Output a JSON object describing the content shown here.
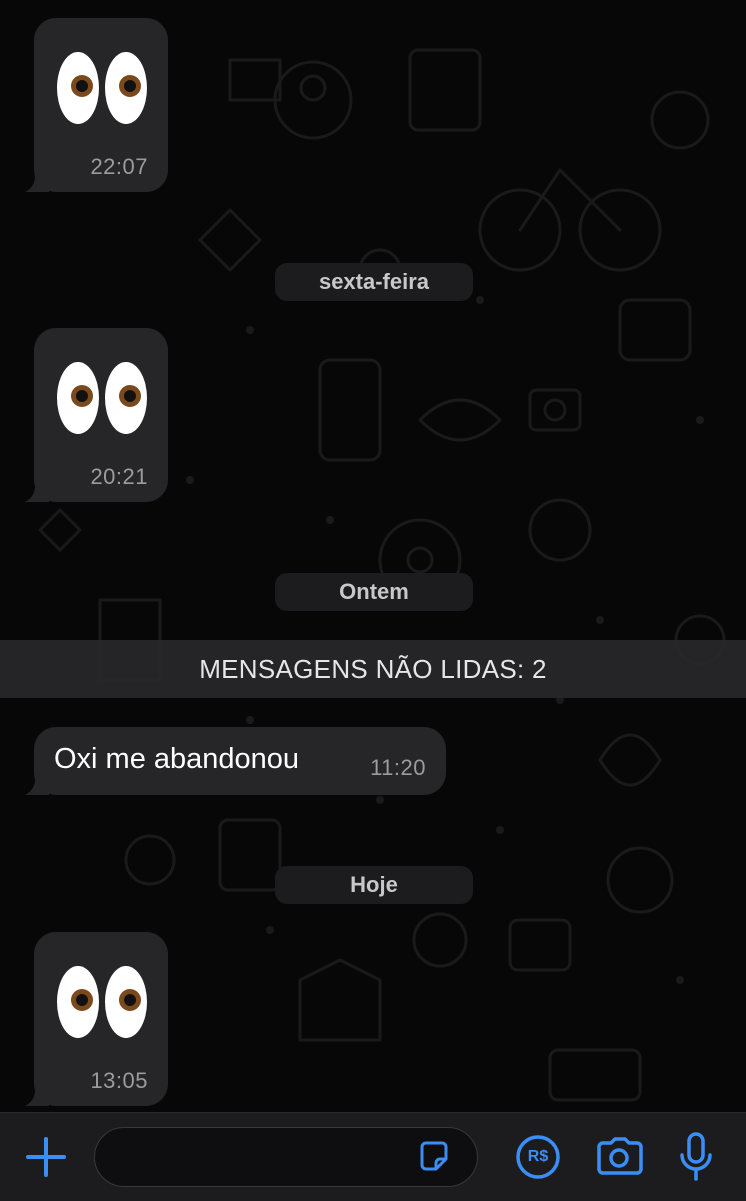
{
  "messages": [
    {
      "type": "emoji",
      "emoji_name": "eyes-emoji",
      "time": "22:07"
    },
    {
      "type": "emoji",
      "emoji_name": "eyes-emoji",
      "time": "20:21"
    },
    {
      "type": "text",
      "text": "Oxi me abandonou",
      "time": "11:20"
    },
    {
      "type": "emoji",
      "emoji_name": "eyes-emoji",
      "time": "13:05"
    }
  ],
  "day_separators": [
    "sexta-feira",
    "Ontem",
    "Hoje"
  ],
  "unread_banner": "MENSAGENS NÃO LIDAS: 2",
  "composer": {
    "icons": [
      "plus-icon",
      "sticker-icon",
      "payment-icon",
      "camera-icon",
      "microphone-icon"
    ],
    "payment_label": "R$",
    "input_value": ""
  },
  "colors": {
    "background": "#070707",
    "bubble": "#262628",
    "accent": "#3a8ef6",
    "time_text": "#9b9ba0"
  }
}
